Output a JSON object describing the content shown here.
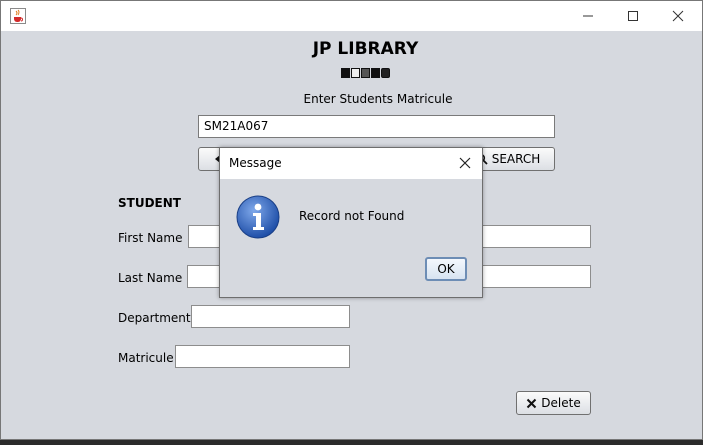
{
  "window": {
    "title": "",
    "icons": {
      "app": "java-cup-icon",
      "minimize": "minimize-icon",
      "maximize": "maximize-icon",
      "close": "close-icon"
    }
  },
  "header": {
    "title": "JP LIBRARY",
    "prompt": "Enter Students Matricule"
  },
  "search": {
    "matricule_value": "SM21A067",
    "search_label": "SEARCH",
    "back_icon": "arrow-left-icon",
    "search_icon": "magnifier-icon"
  },
  "student": {
    "section_title": "STUDENT",
    "first_name_label": "First Name",
    "last_name_label": "Last Name",
    "department_label": "Department",
    "matricule_label": "Matricule"
  },
  "actions": {
    "delete_label": "Delete",
    "delete_icon": "x-icon"
  },
  "dialog": {
    "title": "Message",
    "message": "Record not Found",
    "ok_label": "OK",
    "icon": "information-icon"
  },
  "colors": {
    "window_bg": "#d6d9df",
    "info_blue": "#2a5cb8",
    "ok_border": "#6d8db5"
  }
}
